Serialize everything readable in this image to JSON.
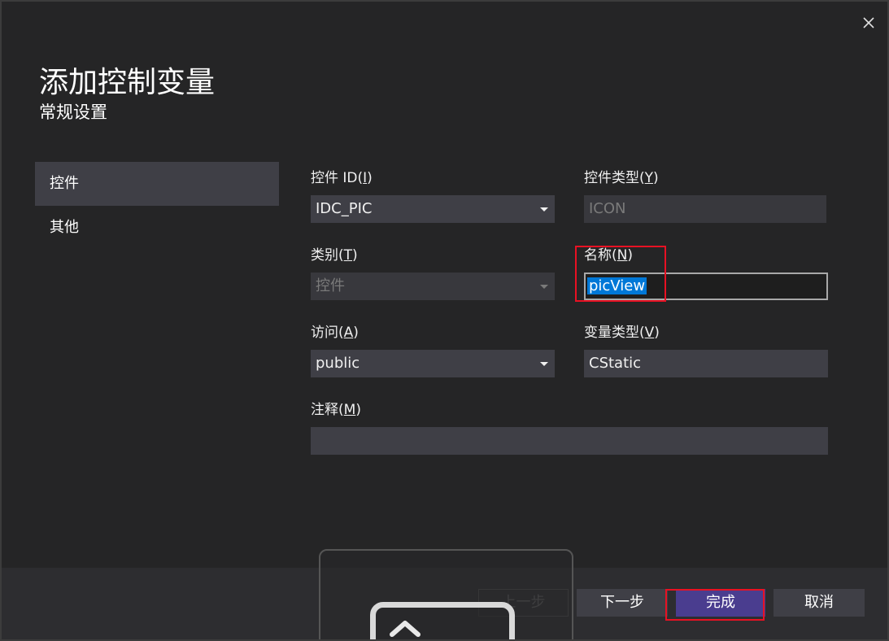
{
  "dialog": {
    "title": "添加控制变量",
    "subtitle": "常规设置"
  },
  "nav": {
    "items": [
      {
        "label": "控件",
        "active": true
      },
      {
        "label": "其他",
        "active": false
      }
    ]
  },
  "fields": {
    "control_id": {
      "label": "控件 ID(",
      "accel": "I",
      "label_end": ")",
      "value": "IDC_PIC"
    },
    "control_type": {
      "label": "控件类型(",
      "accel": "Y",
      "label_end": ")",
      "value": "ICON"
    },
    "category": {
      "label": "类别(",
      "accel": "T",
      "label_end": ")",
      "value": "控件"
    },
    "name": {
      "label": "名称(",
      "accel": "N",
      "label_end": ")",
      "value": "picView"
    },
    "access": {
      "label": "访问(",
      "accel": "A",
      "label_end": ")",
      "value": "public"
    },
    "var_type": {
      "label": "变量类型(",
      "accel": "V",
      "label_end": ")",
      "value": "CStatic"
    },
    "comment": {
      "label": "注释(",
      "accel": "M",
      "label_end": ")",
      "value": ""
    }
  },
  "footer": {
    "prev_label": "上一步",
    "next_label": "下一步",
    "finish_label": "完成",
    "cancel_label": "取消"
  },
  "colors": {
    "background": "#252526",
    "field": "#3f3f46",
    "primary_button": "#4a3d8f",
    "highlight_outline": "#e81123",
    "selection": "#0078d7"
  },
  "icons": {
    "close": "close-icon",
    "dropdown": "chevron-down-icon",
    "overlay": "chevron-up-icon"
  }
}
